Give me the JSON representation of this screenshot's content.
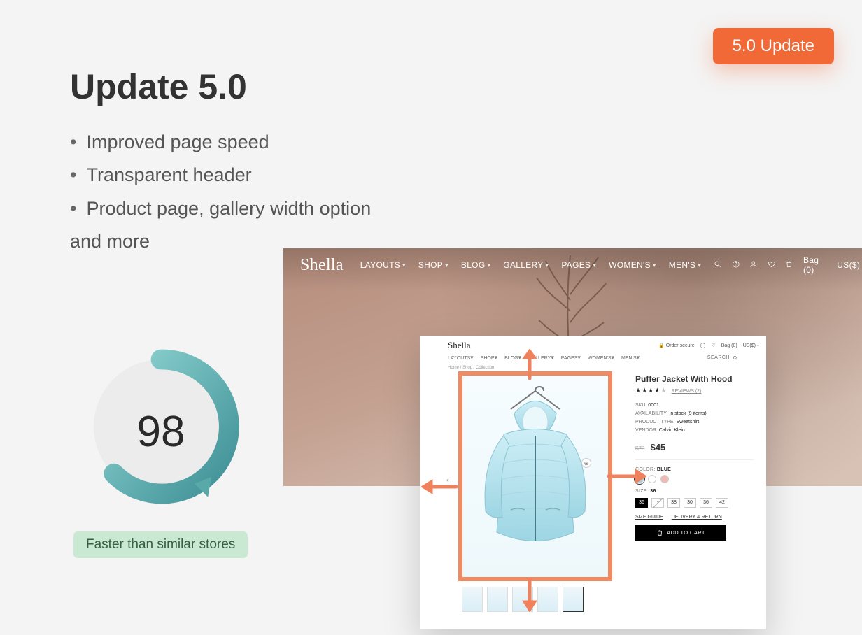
{
  "badge": {
    "text": "5.0 Update"
  },
  "heading": "Update 5.0",
  "bullets": {
    "items": [
      "Improved page speed",
      "Transparent header",
      "Product page, gallery width option"
    ],
    "tail": "and more"
  },
  "gauge": {
    "score": "98",
    "caption": "Faster than similar stores"
  },
  "hero": {
    "logo": "Shella",
    "menu": {
      "layouts": "LAYOUTS",
      "shop": "SHOP",
      "blog": "BLOG",
      "gallery": "GALLERY",
      "pages": "PAGES",
      "womens": "WOMEN'S",
      "mens": "MEN'S"
    },
    "right": {
      "bag": "Bag (0)",
      "currency": "US($)"
    }
  },
  "product_card": {
    "logo": "Shella",
    "menu": {
      "layouts": "LAYOUTS",
      "shop": "SHOP",
      "blog": "BLOG",
      "gallery": "GALLERY",
      "pages": "PAGES",
      "womens": "WOMEN'S",
      "mens": "MEN'S"
    },
    "right": {
      "secure": "Order secure",
      "bag": "Bag (0)",
      "currency": "US($)"
    },
    "breadcrumb": "Home  /  Shop  /  Collection",
    "search": "SEARCH",
    "title": "Puffer Jacket With Hood",
    "reviews": "REVIEWS (2)",
    "meta": {
      "sku_label": "SKU:",
      "sku_value": "0001",
      "avail_label": "AVAILABILITY:",
      "avail_value": "In stock (9 items)",
      "ptype_label": "PRODUCT TYPE:",
      "ptype_value": "Sweatshirt",
      "vendor_label": "VENDOR:",
      "vendor_value": "Calvin Klein"
    },
    "price": {
      "old": "$78",
      "new": "$45"
    },
    "color": {
      "label": "COLOR:",
      "value": "BLUE"
    },
    "size": {
      "label": "SIZE:",
      "value": "36",
      "options": [
        "36",
        "-",
        "38",
        "30",
        "36",
        "42"
      ]
    },
    "links": {
      "guide": "SIZE GUIDE",
      "delivery": "DELIVERY & RETURN"
    },
    "add": "ADD TO CART"
  }
}
